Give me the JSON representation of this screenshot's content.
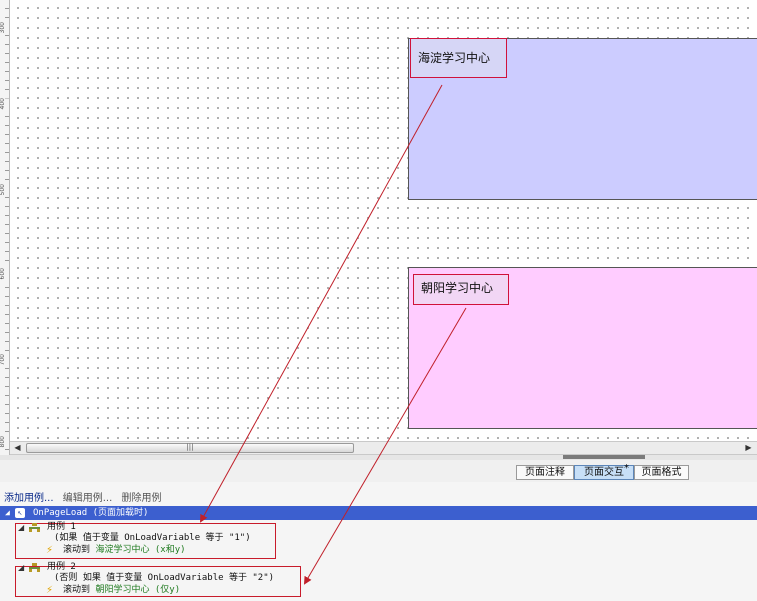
{
  "panels": {
    "haidian": {
      "label": "海淀学习中心",
      "color": "#ccccff"
    },
    "chaoyang": {
      "label": "朝阳学习中心",
      "color": "#ffccff"
    }
  },
  "ruler": {
    "ticks": [
      "300",
      "400",
      "500",
      "600",
      "700",
      "800"
    ]
  },
  "scrollbar": {
    "grip": "|||"
  },
  "tabs": {
    "notes": "页面注释",
    "interaction": "页面交互",
    "format": "页面格式",
    "marker": "*"
  },
  "toolbar": {
    "add": "添加用例...",
    "edit": "编辑用例...",
    "delete": "删除用例"
  },
  "event": {
    "name": "OnPageLoad",
    "desc": "(页面加载时)"
  },
  "cases": [
    {
      "name": "用例 1",
      "condition": "(如果 值于变量 OnLoadVariable 等于 \"1\")",
      "action_prefix": "滚动到",
      "action_target": "海淀学习中心 (x和y)"
    },
    {
      "name": "用例 2",
      "condition": "(否则 如果 值于变量 OnLoadVariable 等于 \"2\")",
      "action_prefix": "滚动到",
      "action_target": "朝阳学习中心 (仅y)"
    }
  ],
  "colors": {
    "accent_event_row": "#3c5fcf",
    "highlight_box": "#c81b2b",
    "arrow": "#c0202a"
  },
  "icons": [
    "interaction-event-icon",
    "case-icon",
    "lightning-action-icon",
    "expand-triangle-icon",
    "scroll-left-icon",
    "scroll-right-icon"
  ]
}
